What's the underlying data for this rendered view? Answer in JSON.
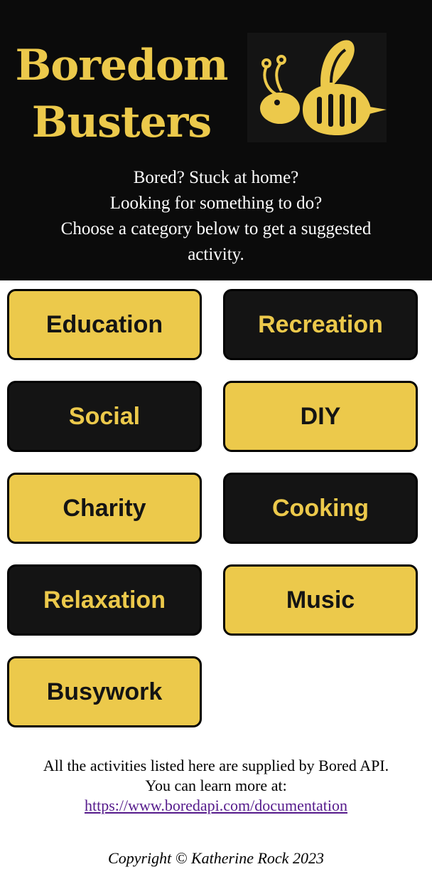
{
  "header": {
    "title_line1": "Boredom",
    "title_line2": "Busters",
    "intro_line1": "Bored? Stuck at home?",
    "intro_line2": "Looking for something to do?",
    "intro_line3": "Choose a category below to get a suggested",
    "intro_line4": "activity."
  },
  "categories": [
    {
      "label": "Education",
      "style": "yellow"
    },
    {
      "label": "Recreation",
      "style": "dark"
    },
    {
      "label": "Social",
      "style": "dark"
    },
    {
      "label": "DIY",
      "style": "yellow"
    },
    {
      "label": "Charity",
      "style": "yellow"
    },
    {
      "label": "Cooking",
      "style": "dark"
    },
    {
      "label": "Relaxation",
      "style": "dark"
    },
    {
      "label": "Music",
      "style": "yellow"
    },
    {
      "label": "Busywork",
      "style": "yellow"
    }
  ],
  "footer": {
    "line1": "All the activities listed here are supplied by Bored API.",
    "line2": "You can learn more at:",
    "link_text": "https://www.boredapi.com/documentation",
    "copyright": "Copyright © Katherine Rock 2023"
  },
  "colors": {
    "brand_yellow": "#ecc94b",
    "brand_dark": "#141414",
    "header_bg": "#0b0b0b",
    "link": "#551a8b"
  },
  "icons": {
    "logo": "bee-icon"
  }
}
